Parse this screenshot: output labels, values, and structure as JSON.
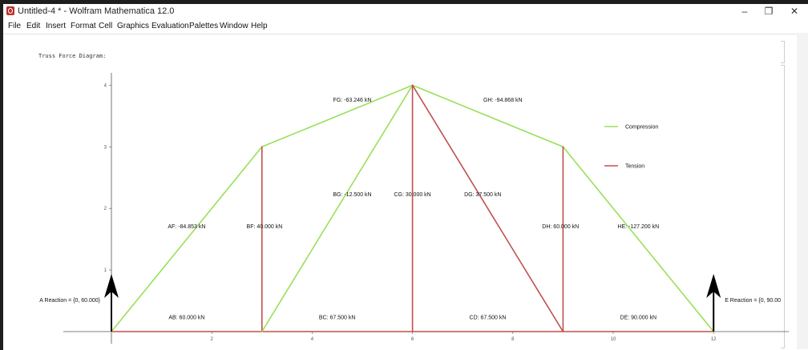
{
  "window": {
    "title": "Untitled-4 * - Wolfram Mathematica 12.0",
    "minimize_glyph": "–",
    "restore_glyph": "❐",
    "close_glyph": "✕",
    "app_icon": "mathematica-icon"
  },
  "menu": [
    "File",
    "Edit",
    "Insert",
    "Format",
    "Cell",
    "Graphics",
    "Evaluation",
    "Palettes",
    "Window",
    "Help"
  ],
  "cell": {
    "output_label": "Truss Force Diagram:"
  },
  "colors": {
    "compression": "#99e05a",
    "tension": "#c0504d",
    "reaction_arrow": "#000000",
    "axis": "#555555"
  },
  "chart_data": {
    "type": "diagram",
    "xlim": [
      0,
      13.5
    ],
    "ylim": [
      -0.2,
      4.2
    ],
    "x_ticks": [
      2,
      4,
      6,
      8,
      10,
      12
    ],
    "y_ticks": [
      1,
      2,
      3,
      4
    ],
    "legend": [
      {
        "label": "Compression",
        "kind": "compression"
      },
      {
        "label": "Tension",
        "kind": "tension"
      }
    ],
    "members": [
      {
        "name": "AB",
        "from": [
          0,
          0
        ],
        "to": [
          3,
          0
        ],
        "kind": "tension"
      },
      {
        "name": "BC",
        "from": [
          3,
          0
        ],
        "to": [
          6,
          0
        ],
        "kind": "tension"
      },
      {
        "name": "CD",
        "from": [
          6,
          0
        ],
        "to": [
          9,
          0
        ],
        "kind": "tension"
      },
      {
        "name": "DE",
        "from": [
          9,
          0
        ],
        "to": [
          12,
          0
        ],
        "kind": "tension"
      },
      {
        "name": "AF",
        "from": [
          0,
          0
        ],
        "to": [
          3,
          3
        ],
        "kind": "compression"
      },
      {
        "name": "FG",
        "from": [
          3,
          3
        ],
        "to": [
          6,
          4
        ],
        "kind": "compression"
      },
      {
        "name": "GH",
        "from": [
          6,
          4
        ],
        "to": [
          9,
          3
        ],
        "kind": "compression"
      },
      {
        "name": "HE",
        "from": [
          9,
          3
        ],
        "to": [
          12,
          0
        ],
        "kind": "compression"
      },
      {
        "name": "BF",
        "from": [
          3,
          0
        ],
        "to": [
          3,
          3
        ],
        "kind": "tension"
      },
      {
        "name": "BG",
        "from": [
          3,
          0
        ],
        "to": [
          6,
          4
        ],
        "kind": "compression"
      },
      {
        "name": "CG",
        "from": [
          6,
          0
        ],
        "to": [
          6,
          4
        ],
        "kind": "tension"
      },
      {
        "name": "DG",
        "from": [
          9,
          0
        ],
        "to": [
          6,
          4
        ],
        "kind": "tension"
      },
      {
        "name": "DH",
        "from": [
          9,
          0
        ],
        "to": [
          9,
          3
        ],
        "kind": "tension"
      }
    ],
    "force_labels": [
      {
        "text": "FG: -63.246 kN",
        "x": 4.8,
        "y": 3.73
      },
      {
        "text": "GH: -94.868 kN",
        "x": 7.8,
        "y": 3.73
      },
      {
        "text": "BG: -12.500 kN",
        "x": 4.8,
        "y": 2.2
      },
      {
        "text": "CG: 30.000 kN",
        "x": 6.0,
        "y": 2.2
      },
      {
        "text": "DG: 37.500 kN",
        "x": 7.4,
        "y": 2.2
      },
      {
        "text": "AF: -84.853 kN",
        "x": 1.5,
        "y": 1.68
      },
      {
        "text": "BF: 40.000 kN",
        "x": 3.05,
        "y": 1.68
      },
      {
        "text": "DH: 60.000 kN",
        "x": 8.95,
        "y": 1.68
      },
      {
        "text": "HE: -127.200 kN",
        "x": 10.5,
        "y": 1.68
      },
      {
        "text": "AB: 60.000 kN",
        "x": 1.5,
        "y": 0.2
      },
      {
        "text": "BC: 67.500 kN",
        "x": 4.5,
        "y": 0.2
      },
      {
        "text": "CD: 67.500 kN",
        "x": 7.5,
        "y": 0.2
      },
      {
        "text": "DE: 90.000 kN",
        "x": 10.5,
        "y": 0.2
      }
    ],
    "reactions": [
      {
        "text": "A Reaction = {0, 60.000}",
        "x": 0,
        "value": 60.0,
        "anchor": "end"
      },
      {
        "text": "E Reaction = {0, 90.00",
        "x": 12,
        "value": 90.0,
        "anchor": "start"
      }
    ]
  }
}
